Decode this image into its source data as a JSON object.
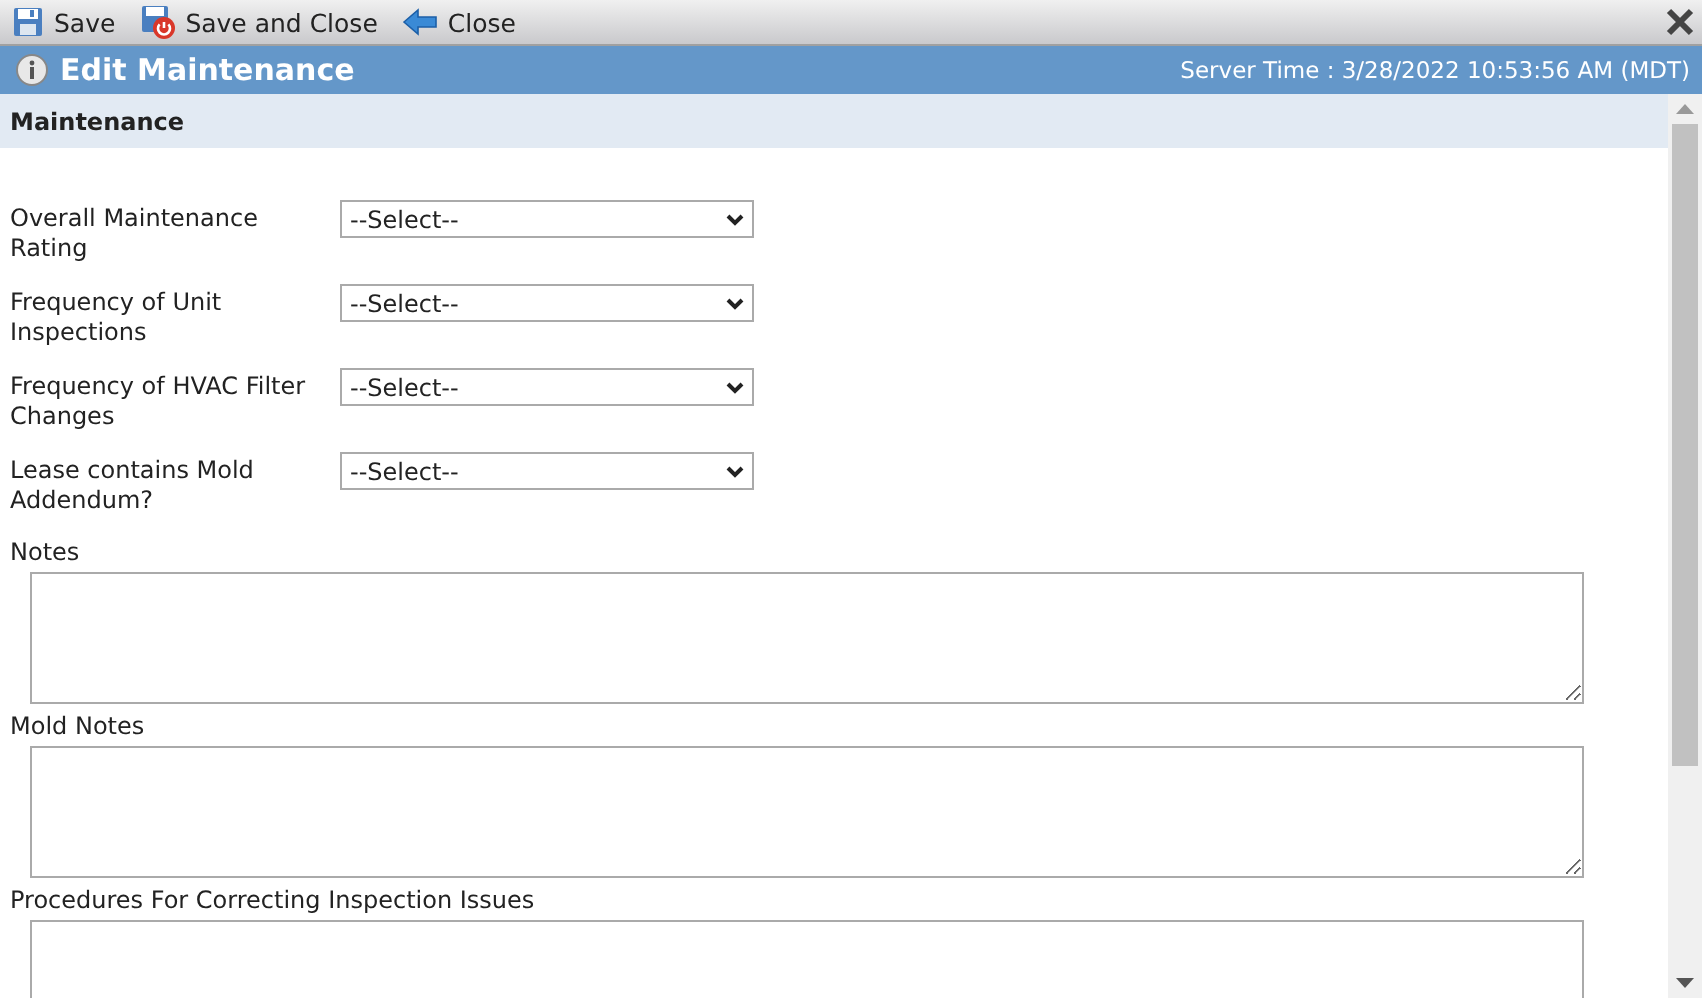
{
  "toolbar": {
    "buttons": [
      {
        "kind": "save",
        "label": "Save"
      },
      {
        "kind": "save-close",
        "label": "Save and Close"
      },
      {
        "kind": "close",
        "label": "Close"
      }
    ]
  },
  "header": {
    "title": "Edit Maintenance",
    "server_time": "Server Time : 3/28/2022 10:53:56 AM (MDT)"
  },
  "section": {
    "title": "Maintenance"
  },
  "selects": [
    {
      "label": "Overall Maintenance Rating",
      "value": "--Select--"
    },
    {
      "label": "Frequency of Unit Inspections",
      "value": "--Select--"
    },
    {
      "label": "Frequency of HVAC Filter Changes",
      "value": "--Select--"
    },
    {
      "label": "Lease contains Mold Addendum?",
      "value": "--Select--"
    }
  ],
  "textareas": [
    {
      "label": "Notes"
    },
    {
      "label": "Mold Notes"
    },
    {
      "label": "Procedures For Correcting Inspection Issues"
    }
  ]
}
